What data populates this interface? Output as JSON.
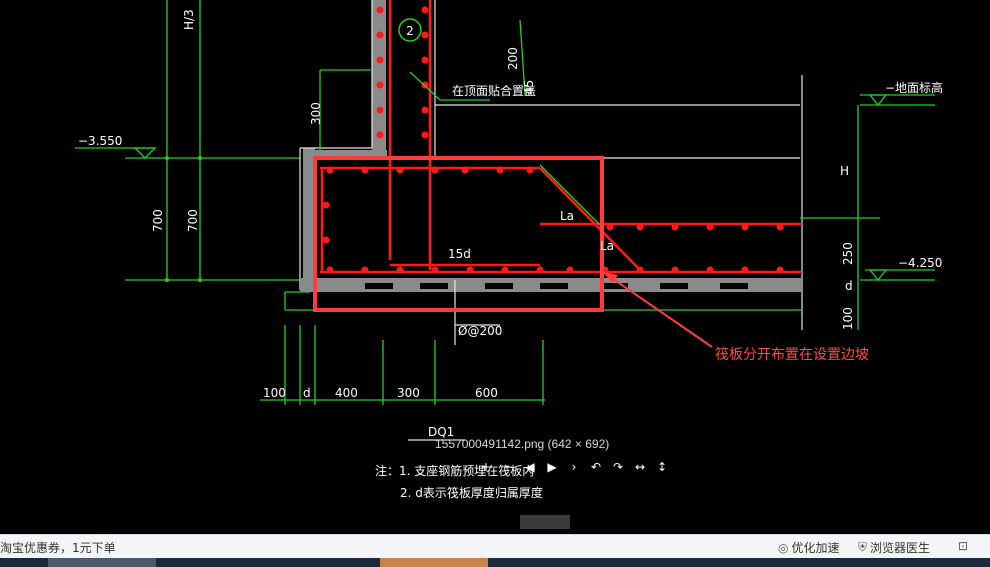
{
  "drawing": {
    "labels": {
      "h3": "H/3",
      "circle_num": "2",
      "angle_200": "200",
      "angle_45": "45",
      "leader_top": "在顶面贴合置盖",
      "elev_top_right": "−地面标高",
      "dim_300": "300",
      "elev_left": "−3.550",
      "h": "H",
      "la1": "La",
      "la2": "La",
      "d15": "15d",
      "dim_700a": "700",
      "dim_700b": "700",
      "dim_250": "250",
      "elev_right": "−4.250",
      "d_small": "d",
      "dim_100r": "100",
      "at200": "Ø@200",
      "b100": "100",
      "bd": "d",
      "b400": "400",
      "b300": "300",
      "b600": "600",
      "title": "DQ1",
      "note1": "注：1. 支座钢筋预埋在筏板内",
      "note2": "2. d表示筏板厚度归属厚度"
    }
  },
  "viewer": {
    "file_caption": "1557000491142.png (642 × 692)",
    "toolbar": [
      {
        "name": "zoom-in-icon",
        "glyph": "+"
      },
      {
        "name": "zoom-out-icon",
        "glyph": "−"
      },
      {
        "name": "prev-icon",
        "glyph": "◀"
      },
      {
        "name": "play-icon",
        "glyph": "▶"
      },
      {
        "name": "next-icon",
        "glyph": "›"
      },
      {
        "name": "rotate-left-icon",
        "glyph": "↶"
      },
      {
        "name": "rotate-right-icon",
        "glyph": "↷"
      },
      {
        "name": "fit-width-icon",
        "glyph": "↔"
      },
      {
        "name": "fit-height-icon",
        "glyph": "↕"
      }
    ]
  },
  "annotation": {
    "label": "筏板分开布置在设置边坡",
    "color": "#ff3b3b"
  },
  "statusbar": {
    "ad_text": "淘宝优惠券，1元下单",
    "speedup_label": "优化加速",
    "doctor_label": "浏览器医生"
  }
}
